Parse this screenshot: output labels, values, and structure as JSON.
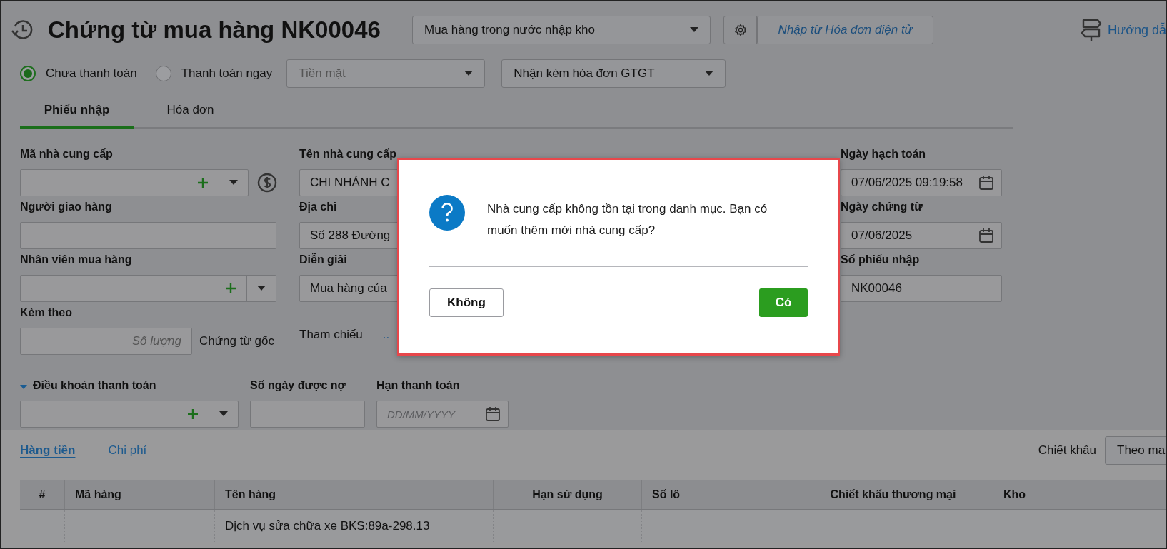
{
  "header": {
    "title": "Chứng từ mua hàng NK00046",
    "voucher_type": "Mua hàng trong nước nhập kho",
    "import_button": "Nhập từ Hóa đơn điện tử",
    "help_link": "Hướng dẫ"
  },
  "payment": {
    "options": [
      {
        "label": "Chưa thanh toán",
        "selected": true
      },
      {
        "label": "Thanh toán ngay",
        "selected": false
      }
    ],
    "method": {
      "value": "Tiền mặt",
      "disabled": true
    },
    "invoice": "Nhận kèm hóa đơn GTGT"
  },
  "tabs": [
    {
      "label": "Phiếu nhập",
      "selected": true
    },
    {
      "label": "Hóa đơn",
      "selected": false
    }
  ],
  "form": {
    "supplier_code": {
      "label": "Mã nhà cung cấp"
    },
    "deliverer": {
      "label": "Người giao hàng"
    },
    "buyer": {
      "label": "Nhân viên mua hàng"
    },
    "attachments": {
      "label": "Kèm theo",
      "placeholder": "Số lượng",
      "suffix": "Chứng từ gốc"
    },
    "supplier_name": {
      "label": "Tên nhà cung cấp",
      "value": "CHI NHÁNH C"
    },
    "address": {
      "label": "Địa chỉ",
      "value": "Số 288 Đường"
    },
    "description": {
      "label": "Diễn giải",
      "value": "Mua hàng của"
    },
    "reference": {
      "label": "Tham chiếu",
      "link": ".."
    },
    "posting_date": {
      "label": "Ngày hạch toán",
      "value": "07/06/2025 09:19:58"
    },
    "voucher_date": {
      "label": "Ngày chứng từ",
      "value": "07/06/2025"
    },
    "voucher_no": {
      "label": "Số phiếu nhập",
      "value": "NK00046"
    }
  },
  "terms": {
    "label": "Điều khoản thanh toán",
    "expanded": true,
    "days_label": "Số ngày được nợ",
    "due_label": "Hạn thanh toán",
    "due_placeholder": "DD/MM/YYYY"
  },
  "detail_tabs": [
    {
      "label": "Hàng tiền",
      "selected": true
    },
    {
      "label": "Chi phí",
      "selected": false
    }
  ],
  "discount": {
    "label": "Chiết khấu",
    "value": "Theo ma"
  },
  "table": {
    "columns": [
      "#",
      "Mã hàng",
      "Tên hàng",
      "Hạn sử dụng",
      "Số lô",
      "Chiết khấu thương mại",
      "Kho"
    ],
    "rows": [
      {
        "item_name": "Dịch vụ sửa chữa xe BKS:89a-298.13"
      }
    ]
  },
  "dialog": {
    "message": "Nhà cung cấp không tồn tại trong danh mục. Bạn có muốn thêm mới nhà cung cấp?",
    "buttons": [
      {
        "label": "Không",
        "kind": "secondary"
      },
      {
        "label": "Có",
        "kind": "primary"
      }
    ]
  }
}
